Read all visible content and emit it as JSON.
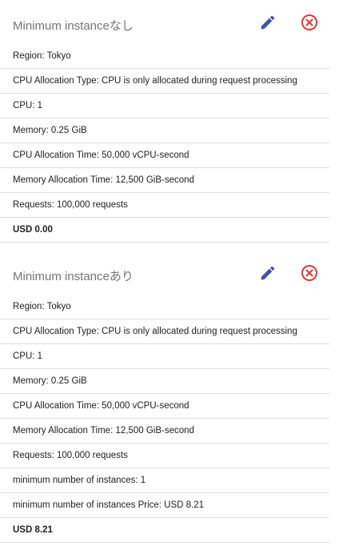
{
  "estimates": [
    {
      "title": "Minimum instanceなし",
      "rows": [
        "Region: Tokyo",
        "CPU Allocation Type: CPU is only allocated during request processing",
        "CPU: 1",
        "Memory: 0.25 GiB",
        "CPU Allocation Time: 50,000 vCPU-second",
        "Memory Allocation Time: 12,500 GiB-second",
        "Requests: 100,000 requests"
      ],
      "total": "USD 0.00"
    },
    {
      "title": "Minimum instanceあり",
      "rows": [
        "Region: Tokyo",
        "CPU Allocation Type: CPU is only allocated during request processing",
        "CPU: 1",
        "Memory: 0.25 GiB",
        "CPU Allocation Time: 50,000 vCPU-second",
        "Memory Allocation Time: 12,500 GiB-second",
        "Requests: 100,000 requests",
        "minimum number of instances: 1",
        "minimum number of instances Price: USD 8.21"
      ],
      "total": "USD 8.21"
    }
  ],
  "colors": {
    "edit_icon": "#3f51b5",
    "remove_icon": "#e53935",
    "title_text": "#757575",
    "divider": "#e0e0e0"
  },
  "icons": {
    "edit": "pencil-icon",
    "remove": "close-circle-icon"
  }
}
